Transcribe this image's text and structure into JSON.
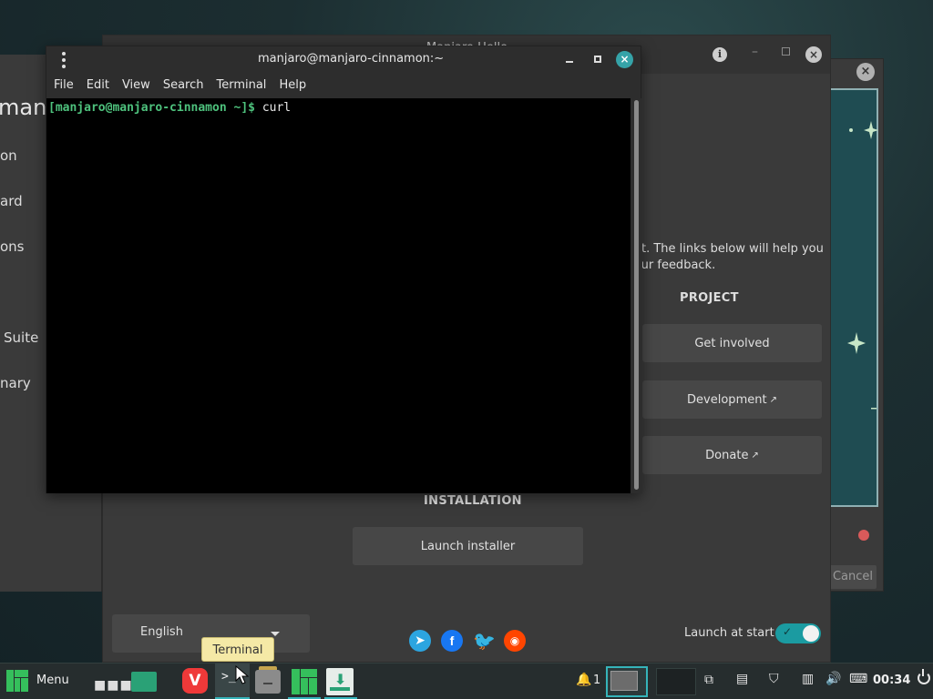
{
  "left_window": {
    "logo_partial": "manj",
    "items": [
      "on",
      "ard",
      "ons",
      "Suite",
      "nary"
    ]
  },
  "right_window": {
    "cancel_label": "Cancel"
  },
  "hello_window": {
    "title": "Manjaro Hello",
    "welcome_text": "g it. The links below will help you\n your feedback.",
    "project_title": "PROJECT",
    "get_involved_label": "Get involved",
    "development_label": "Development",
    "donate_label": "Donate",
    "installation_title": "INSTALLATION",
    "launch_installer_label": "Launch installer",
    "language_value": "English",
    "launch_at_start_label": "Launch at start",
    "launch_at_start_enabled": true
  },
  "terminal": {
    "title": "manjaro@manjaro-cinnamon:~",
    "menu": [
      "File",
      "Edit",
      "View",
      "Search",
      "Terminal",
      "Help"
    ],
    "prompt_user": "[manjaro@manjaro-cinnamon ~]$",
    "command": "curl"
  },
  "tooltip": {
    "text": "Terminal"
  },
  "taskbar": {
    "menu_label": "Menu",
    "notification_count": "1",
    "clock": "00:34"
  },
  "colors": {
    "accent": "#35b4ba",
    "manjaro_green": "#35bf5c",
    "terminal_prompt": "#4ec27d",
    "toggle_on": "#1b9ba1"
  }
}
